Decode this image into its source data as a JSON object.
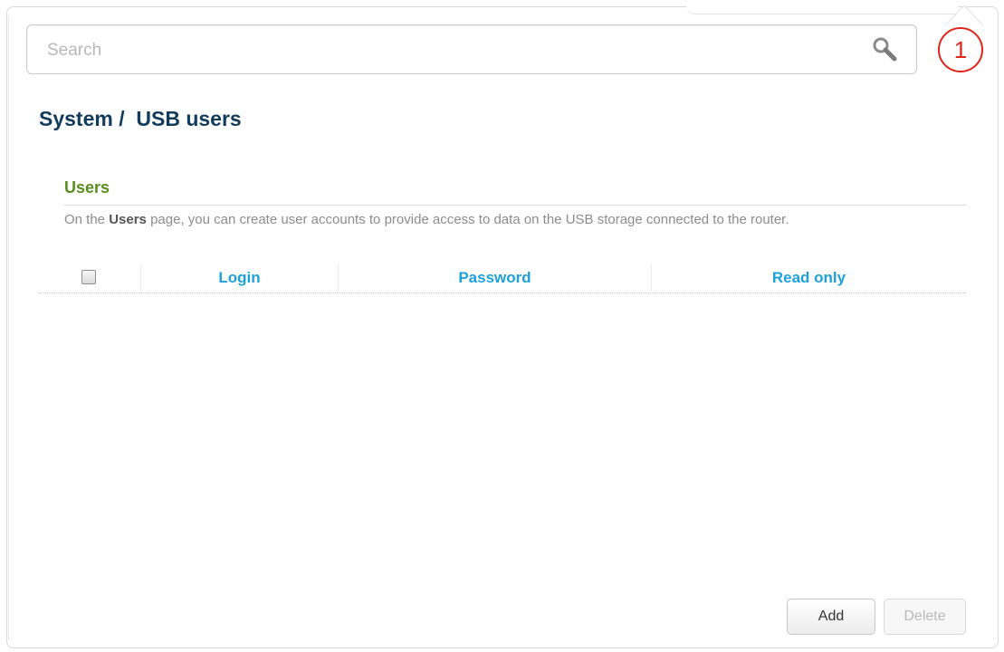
{
  "search": {
    "placeholder": "Search",
    "icon": "search-icon"
  },
  "notification": {
    "count": "1",
    "color": "#e0251b"
  },
  "breadcrumb": {
    "title": "System /  USB users"
  },
  "section": {
    "title": "Users",
    "desc_prefix": "On the ",
    "desc_bold": "Users",
    "desc_suffix": " page, you can create user accounts to provide access to data on the USB storage connected to the router."
  },
  "table": {
    "columns": [
      "Login",
      "Password",
      "Read only"
    ],
    "rows": []
  },
  "actions": {
    "add_label": "Add",
    "delete_label": "Delete"
  },
  "colors": {
    "title": "#123c5c",
    "section_title": "#5a8e1e",
    "column_header": "#1ea1da"
  }
}
